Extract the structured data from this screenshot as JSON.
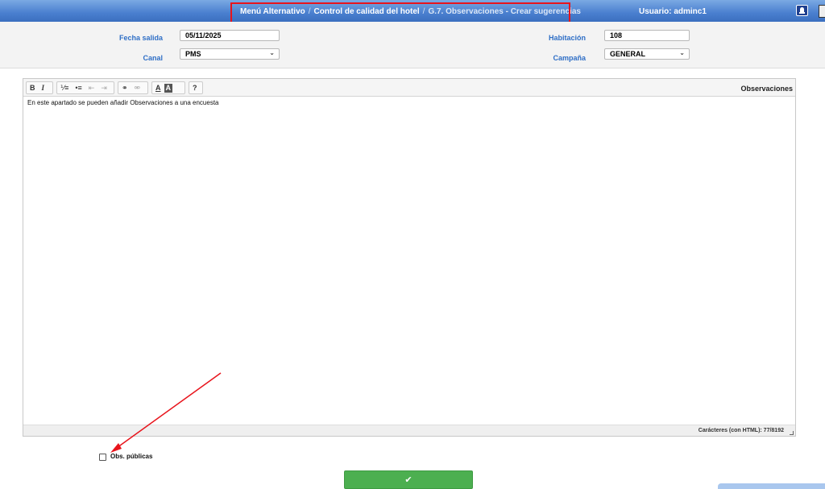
{
  "header": {
    "breadcrumb": [
      "Menú Alternativo",
      "Control de calidad del hotel",
      "G.7. Observaciones - Crear sugerencias"
    ],
    "separator": "/",
    "user": "Usuario: adminc1"
  },
  "filters": {
    "fecha_salida_label": "Fecha salida",
    "fecha_salida_value": "05/11/2025",
    "canal_label": "Canal",
    "canal_value": "PMS",
    "habitacion_label": "Habitación",
    "habitacion_value": "108",
    "campana_label": "Campaña",
    "campana_value": "GENERAL"
  },
  "editor": {
    "title": "Observaciones",
    "toolbar": {
      "bold": "B",
      "italic": "I",
      "ordered_list": "⅟≡",
      "bullet_list": "•≡",
      "outdent": "⇤",
      "indent": "⇥",
      "link": "⚭",
      "unlink": "⚮",
      "font_color": "A",
      "bg_color": "A",
      "help": "?"
    },
    "content": "En este apartado se pueden añadir Observaciones a una encuesta",
    "counter": "Carácteres (con HTML): 77/8192"
  },
  "options": {
    "public_label": "Obs. públicas",
    "public_checked": false
  },
  "submit": {
    "icon": "✔"
  },
  "colors": {
    "header": "#4a7fcf",
    "label_blue": "#2f6fc6",
    "submit_green": "#4caf50",
    "annotation_red": "#e8141c"
  }
}
